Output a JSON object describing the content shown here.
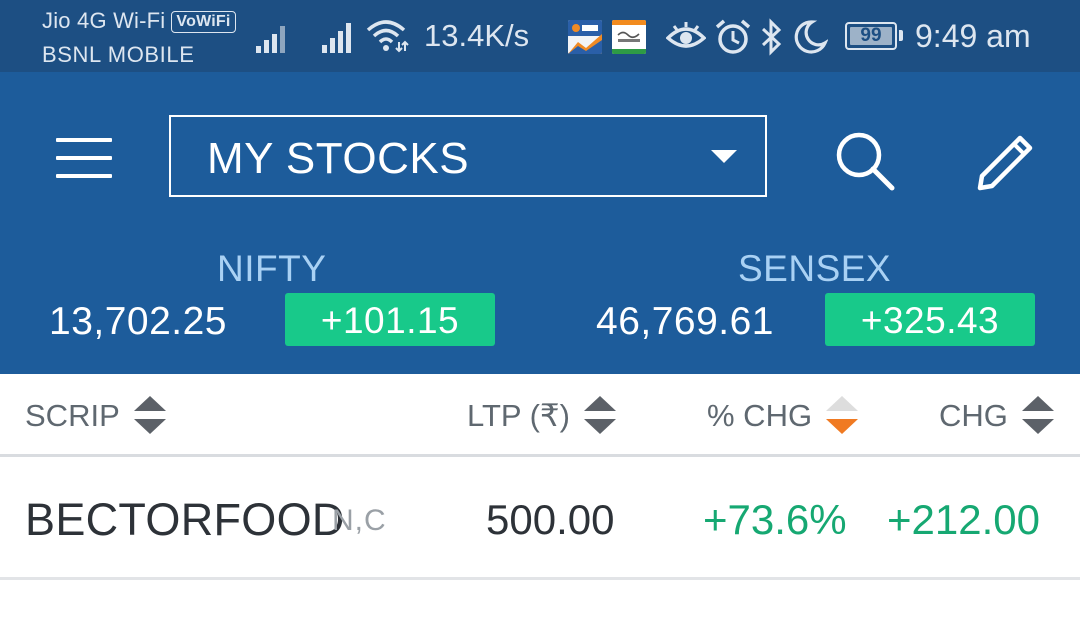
{
  "status_bar": {
    "carrier_primary": "Jio 4G Wi-Fi",
    "vowifi_badge": "VoWiFi",
    "carrier_secondary": "BSNL MOBILE",
    "network_speed": "13.4K/s",
    "battery_level": "99",
    "time": "9:49 am",
    "icons": [
      "signal-icon",
      "signal-icon",
      "wifi-icon",
      "iifl-notification-icon",
      "swachhata-notification-icon",
      "eye-comfort-icon",
      "alarm-icon",
      "bluetooth-icon",
      "do-not-disturb-moon-icon",
      "battery-icon"
    ]
  },
  "header": {
    "watchlist_selector": "MY STOCKS",
    "icons": [
      "menu-icon",
      "chevron-down-icon",
      "search-icon",
      "edit-pencil-icon"
    ]
  },
  "indices": [
    {
      "name": "NIFTY",
      "value": "13,702.25",
      "change": "+101.15"
    },
    {
      "name": "SENSEX",
      "value": "46,769.61",
      "change": "+325.43"
    }
  ],
  "table": {
    "columns": [
      {
        "label": "SCRIP",
        "sort": "none"
      },
      {
        "label": "LTP (₹)",
        "sort": "none"
      },
      {
        "label": "% CHG",
        "sort": "descending"
      },
      {
        "label": "CHG",
        "sort": "none"
      }
    ],
    "rows": [
      {
        "scrip": "BECTORFOOD",
        "exchange_tag": "N,C",
        "ltp": "500.00",
        "pct_change": "+73.6%",
        "change": "+212.00"
      }
    ]
  },
  "colors": {
    "status_bar_bg": "#1d4f83",
    "header_bg": "#1d5c9b",
    "positive": "#18c98a",
    "positive_text": "#16a872",
    "sort_active": "#f07a22"
  }
}
